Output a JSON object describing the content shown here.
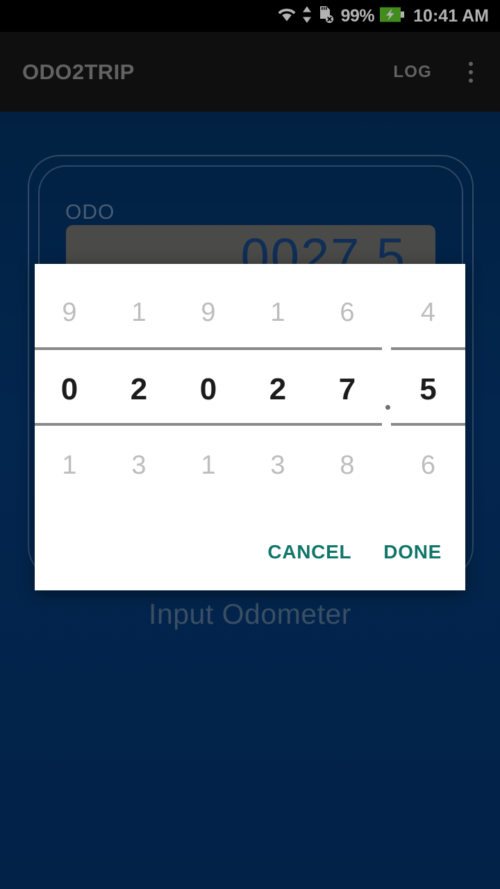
{
  "status_bar": {
    "icons": [
      "wifi-icon",
      "data-transfer-icon",
      "sdcard-error-icon",
      "battery-charging-icon"
    ],
    "battery_percent": "99%",
    "time": "10:41 AM"
  },
  "app_bar": {
    "title": "ODO2TRIP",
    "log_label": "LOG",
    "overflow_icon": "overflow-menu-icon"
  },
  "main": {
    "odo_label": "ODO",
    "odo_value": "0027.5",
    "hint": "Input Odometer"
  },
  "dialog": {
    "picker": {
      "previous_row": [
        "9",
        "1",
        "9",
        "1",
        "6",
        "4"
      ],
      "selected_row": [
        "0",
        "2",
        "0",
        "2",
        "7",
        "5"
      ],
      "next_row": [
        "1",
        "3",
        "1",
        "3",
        "8",
        "6"
      ],
      "decimal_separator": "."
    },
    "cancel_label": "CANCEL",
    "done_label": "DONE"
  },
  "colors": {
    "background_blue": "#05336a",
    "appbar_dark": "#161616",
    "accent_teal": "#10766a",
    "odo_field_gray": "#6b6b68",
    "odo_digit_blue": "#18427c"
  }
}
